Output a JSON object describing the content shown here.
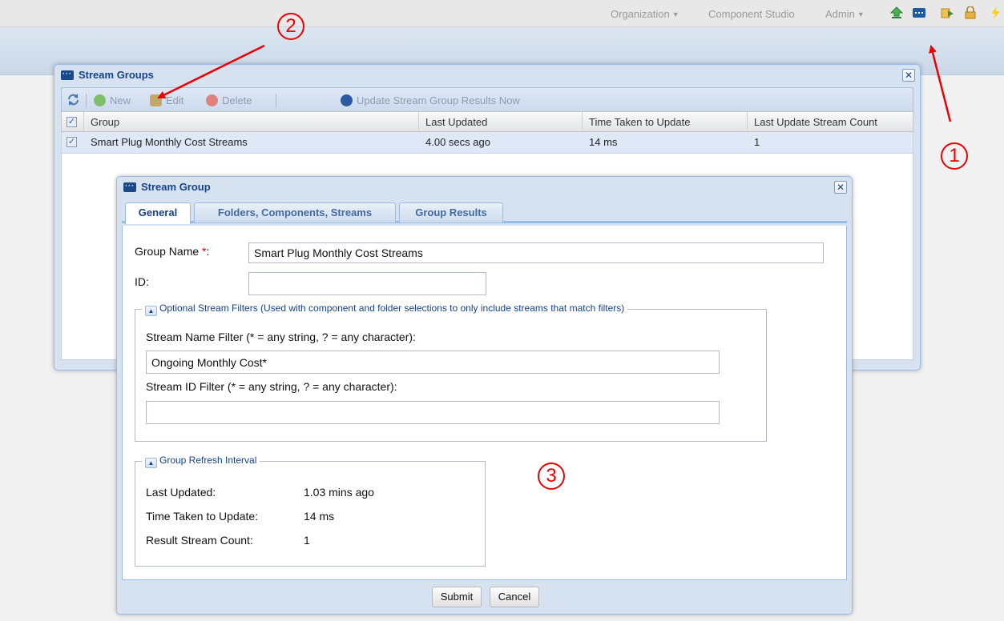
{
  "topnav": {
    "organization": "Organization",
    "component_studio": "Component Studio",
    "admin": "Admin",
    "icons": [
      "upload-icon",
      "window-icon",
      "import-icon",
      "lock-icon",
      "lightning-icon"
    ]
  },
  "stream_groups": {
    "title": "Stream Groups",
    "toolbar": {
      "new": "New",
      "edit": "Edit",
      "delete": "Delete",
      "update_now": "Update Stream Group Results Now"
    },
    "columns": [
      "Group",
      "Last Updated",
      "Time Taken to Update",
      "Last Update Stream Count"
    ],
    "rows": [
      {
        "group": "Smart Plug Monthly Cost Streams",
        "last_updated": "4.00 secs ago",
        "time_taken": "14 ms",
        "count": "1"
      }
    ]
  },
  "dialog": {
    "title": "Stream Group",
    "tabs": [
      "General",
      "Folders, Components, Streams",
      "Group Results"
    ],
    "group_name_label": "Group Name",
    "group_name_required": "*",
    "group_name_colon": ":",
    "group_name_value": "Smart Plug Monthly Cost Streams",
    "id_label": "ID:",
    "id_value": "",
    "filters": {
      "legend": "Optional Stream Filters (Used with component and folder selections to only include streams that match filters)",
      "name_filter_label": "Stream Name Filter (* = any string, ? = any character):",
      "name_filter_value": "Ongoing Monthly Cost*",
      "id_filter_label": "Stream ID Filter (* = any string, ? = any character):",
      "id_filter_value": ""
    },
    "refresh": {
      "legend": "Group Refresh Interval",
      "last_updated_label": "Last Updated:",
      "last_updated_value": "1.03 mins ago",
      "time_taken_label": "Time Taken to Update:",
      "time_taken_value": "14 ms",
      "count_label": "Result Stream Count:",
      "count_value": "1"
    },
    "submit": "Submit",
    "cancel": "Cancel"
  },
  "annotations": {
    "one": "1",
    "two": "2",
    "three": "3",
    "color": "#e00000"
  }
}
